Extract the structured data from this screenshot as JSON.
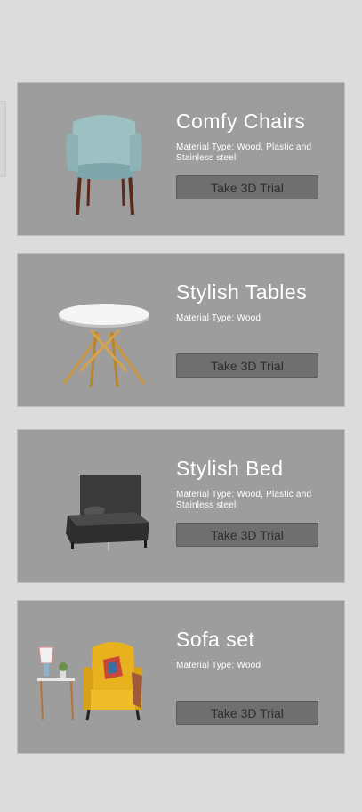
{
  "products": [
    {
      "title": "Comfy Chairs",
      "material": "Material Type: Wood, Plastic and Stainless steel",
      "button": "Take 3D Trial",
      "icon": "armchair-image"
    },
    {
      "title": "Stylish Tables",
      "material": "Material Type: Wood",
      "button": "Take 3D Trial",
      "icon": "round-table-image"
    },
    {
      "title": "Stylish Bed",
      "material": "Material Type: Wood, Plastic and Stainless steel",
      "button": "Take 3D Trial",
      "icon": "bed-image"
    },
    {
      "title": "Sofa set",
      "material": "Material Type: Wood",
      "button": "Take 3D Trial",
      "icon": "sofa-set-image"
    }
  ],
  "colors": {
    "background": "#dcdcdc",
    "card": "#9d9d9d",
    "button": "#6f6f6f",
    "title_text": "#ffffff"
  }
}
